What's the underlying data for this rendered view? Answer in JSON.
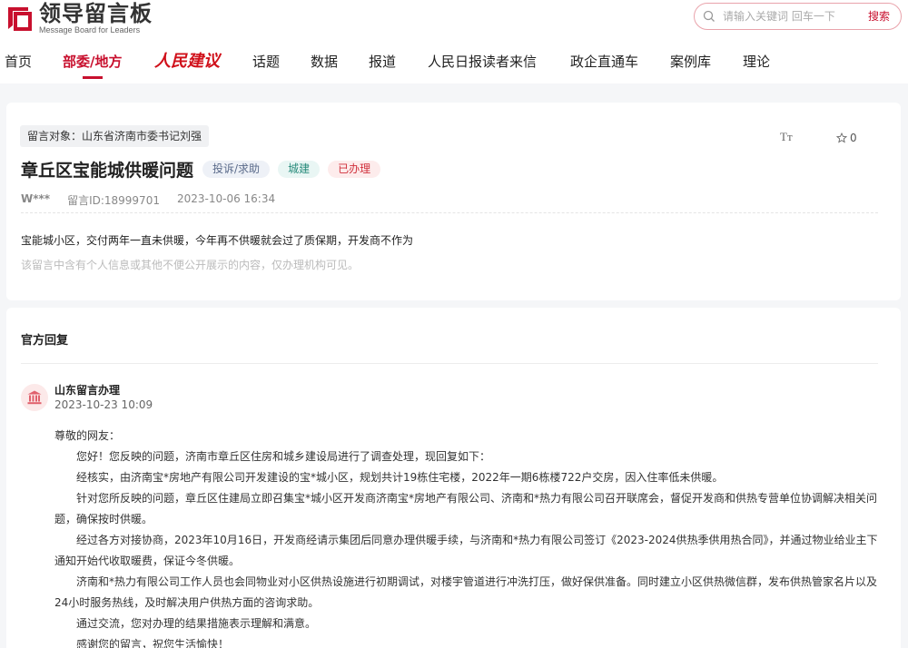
{
  "header": {
    "logo_cn": "领导留言板",
    "logo_en": "Message Board for Leaders",
    "search_placeholder": "请输入关键词 回车一下",
    "search_button": "搜索",
    "brand_color": "#c8102e"
  },
  "nav": {
    "items": [
      {
        "label": "首页"
      },
      {
        "label": "部委/地方",
        "active": true
      },
      {
        "label": "人民建议"
      },
      {
        "label": "话题"
      },
      {
        "label": "数据"
      },
      {
        "label": "报道"
      },
      {
        "label": "人民日报读者来信"
      },
      {
        "label": "政企直通车"
      },
      {
        "label": "案例库"
      },
      {
        "label": "理论"
      }
    ]
  },
  "message": {
    "target_label": "留言对象：山东省济南市委书记刘强",
    "font_toggle": "Tт",
    "fav_count": "0",
    "title": "章丘区宝能城供暖问题",
    "tag_type": "投诉/求助",
    "tag_category": "城建",
    "tag_status": "已办理",
    "author": "W***",
    "message_id": "留言ID:18999701",
    "datetime": "2023-10-06 16:34",
    "content": "宝能城小区，交付两年一直未供暖，今年再不供暖就会过了质保期，开发商不作为",
    "privacy_note": "该留言中含有个人信息或其他不便公开展示的内容，仅办理机构可见。"
  },
  "reply": {
    "section_title": "官方回复",
    "replier": "山东留言办理",
    "date": "2023-10-23 10:09",
    "greeting": "尊敬的网友：",
    "paragraphs": [
      "您好！您反映的问题，济南市章丘区住房和城乡建设局进行了调查处理，现回复如下：",
      "经核实，由济南宝*房地产有限公司开发建设的宝*城小区，规划共计19栋住宅楼，2022年一期6栋楼722户交房，因入住率低未供暖。",
      "针对您所反映的问题，章丘区住建局立即召集宝*城小区开发商济南宝*房地产有限公司、济南和*热力有限公司召开联席会，督促开发商和供热专营单位协调解决相关问题，确保按时供暖。",
      "经过各方对接协商，2023年10月16日，开发商经请示集团后同意办理供暖手续，与济南和*热力有限公司签订《2023-2024供热季供用热合同》，并通过物业给业主下通知开始代收取暖费，保证今冬供暖。",
      "济南和*热力有限公司工作人员也会同物业对小区供热设施进行初期调试，对楼宇管道进行冲洗打压，做好保供准备。同时建立小区供热微信群，发布供热管家名片以及24小时服务热线，及时解决用户供热方面的咨询求助。",
      "通过交流，您对办理的结果措施表示理解和满意。",
      "感谢您的留言，祝您生活愉快！"
    ]
  }
}
